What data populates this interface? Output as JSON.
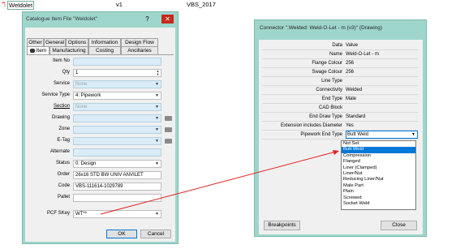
{
  "top": {
    "name": "Weldolet",
    "version": "v1",
    "code": "VBS_2017"
  },
  "left_dialog": {
    "title": "Catalogue Item File \"Weldolet\"",
    "help": "?",
    "tabs_row1": [
      "Other",
      "General",
      "Options",
      "Information",
      "Design Flow"
    ],
    "tabs_row2": [
      "Item",
      "Manufacturing",
      "Costing",
      "Ancillaries"
    ],
    "fields": {
      "item_no": {
        "label": "Item No",
        "value": ""
      },
      "qty": {
        "label": "Qty",
        "value": "1"
      },
      "service": {
        "label": "Service",
        "value": "None"
      },
      "service_type": {
        "label": "Service Type",
        "value": "4: Pipework"
      },
      "section": {
        "label": "Section",
        "value": "None"
      },
      "drawing": {
        "label": "Drawing",
        "value": ""
      },
      "zone": {
        "label": "Zone",
        "value": ""
      },
      "etag": {
        "label": "E-Tag",
        "value": ""
      },
      "alternate": {
        "label": "Alternate",
        "value": "0"
      },
      "status": {
        "label": "Status",
        "value": "0: Design"
      },
      "order": {
        "label": "Order",
        "value": "26x16 STD BW UNIV ANVILET"
      },
      "code": {
        "label": "Code",
        "value": "VBS-111614-1029789"
      },
      "pallet": {
        "label": "Pallet",
        "value": ""
      },
      "pcf_skey": {
        "label": "PCF SKey",
        "value": "WT**"
      }
    },
    "ok": "OK",
    "cancel": "Cancel"
  },
  "right_dialog": {
    "title": "Connector \".Welded: Weld-O-Let - m (v3)\" (Drawing)",
    "rows": [
      {
        "k": "Data",
        "v": "Value"
      },
      {
        "k": "Name",
        "v": "Weld-O-Let - m"
      },
      {
        "k": "Flange Colour",
        "v": "256"
      },
      {
        "k": "Swage Colour",
        "v": "256"
      },
      {
        "k": "Line Type",
        "v": ""
      },
      {
        "k": "Connectivity",
        "v": "Welded"
      },
      {
        "k": "End Type",
        "v": "Male"
      },
      {
        "k": "CAD Block",
        "v": ""
      },
      {
        "k": "End Draw Type",
        "v": "Standard"
      },
      {
        "k": "Extension includes Diameter",
        "v": "Yes"
      },
      {
        "k": "Pipework End Type",
        "v": "Butt Weld"
      }
    ],
    "options": [
      "Not Set",
      "Butt Weld",
      "Compression",
      "Flanged",
      "Liner (Clamped)",
      "Liner/Nut",
      "Reducing Liner/Nut",
      "Male Part",
      "Plain",
      "Screwed",
      "Socket Weld"
    ],
    "selected_option": "Butt Weld",
    "breakpoints": "Breakpoints",
    "close": "Close"
  }
}
